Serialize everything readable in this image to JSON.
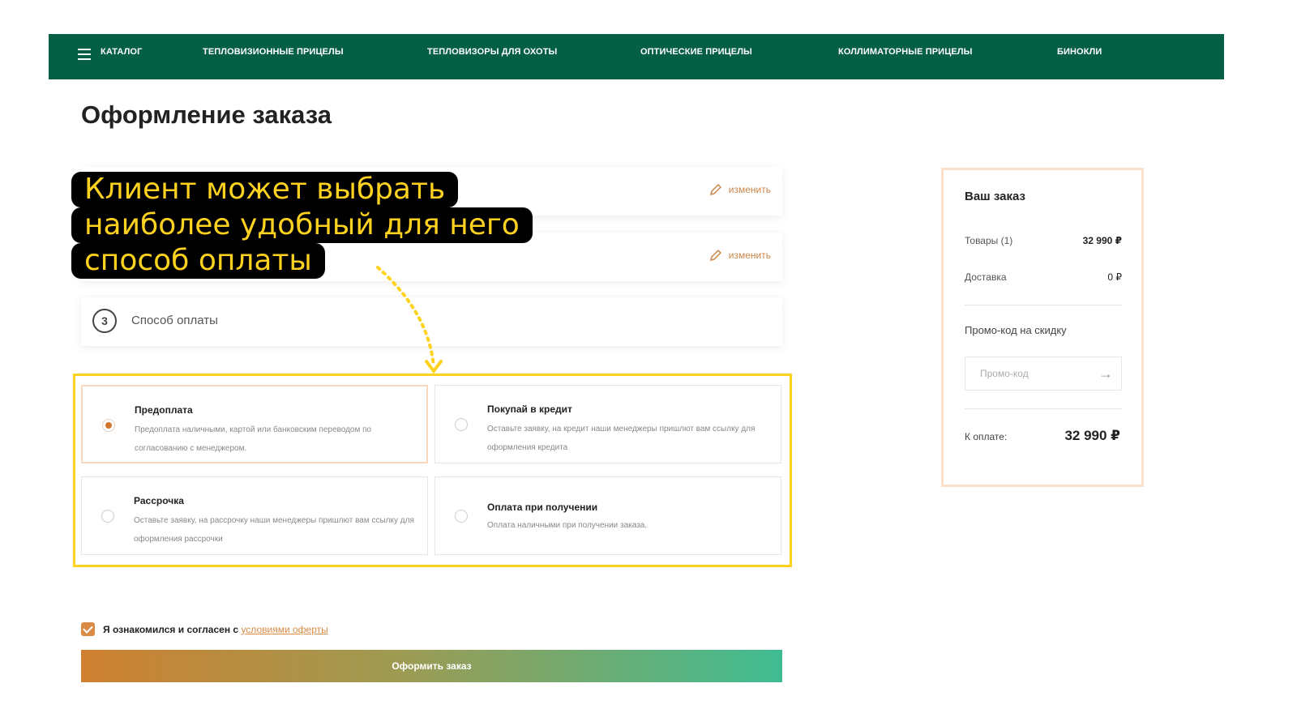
{
  "nav": {
    "catalog": "КАТАЛОГ",
    "items": [
      "ТЕПЛОВИЗИОННЫЕ ПРИЦЕЛЫ",
      "ТЕПЛОВИЗОРЫ ДЛЯ ОХОТЫ",
      "ОПТИЧЕСКИЕ ПРИЦЕЛЫ",
      "КОЛЛИМАТОРНЫЕ ПРИЦЕЛЫ",
      "БИНОКЛИ"
    ]
  },
  "page": {
    "title": "Оформление заказа"
  },
  "steps": {
    "edit_label": "изменить",
    "step3_number": "3",
    "step3_label": "Способ оплаты"
  },
  "callout": {
    "lines": [
      "Клиент может выбрать",
      "наиболее удобный для него",
      "способ оплаты"
    ]
  },
  "payment": {
    "options": [
      {
        "name": "Предоплата",
        "desc": "Предоплата наличными, картой или банковским переводом по согласованию с менеджером.",
        "selected": true
      },
      {
        "name": "Покупай в кредит",
        "desc": "Оставьте заявку, на кредит наши менеджеры пришлют вам ссылку для оформления кредита",
        "selected": false
      },
      {
        "name": "Рассрочка",
        "desc": "Оставьте заявку, на рассрочку наши менеджеры пришлют вам ссылку для оформления рассрочки",
        "selected": false
      },
      {
        "name": "Оплата при получении",
        "desc": "Оплата наличными при получении заказа.",
        "selected": false
      }
    ]
  },
  "agreement": {
    "text": "Я ознакомился и согласен с",
    "link": "условиями оферты",
    "checked": true
  },
  "order_button": "Оформить заказ",
  "summary": {
    "title": "Ваш заказ",
    "goods_label": "Товары (1)",
    "goods_value": "32 990 ₽",
    "delivery_label": "Доставка",
    "delivery_value": "0 ₽",
    "promo_label": "Промо-код на скидку",
    "promo_placeholder": "Промо-код",
    "total_label": "К оплате:",
    "total_value": "32 990 ₽"
  },
  "colors": {
    "nav_bg": "#045f44",
    "accent": "#d98a45",
    "callout_text": "#ffd21f",
    "highlight_frame": "#ffd21f"
  }
}
